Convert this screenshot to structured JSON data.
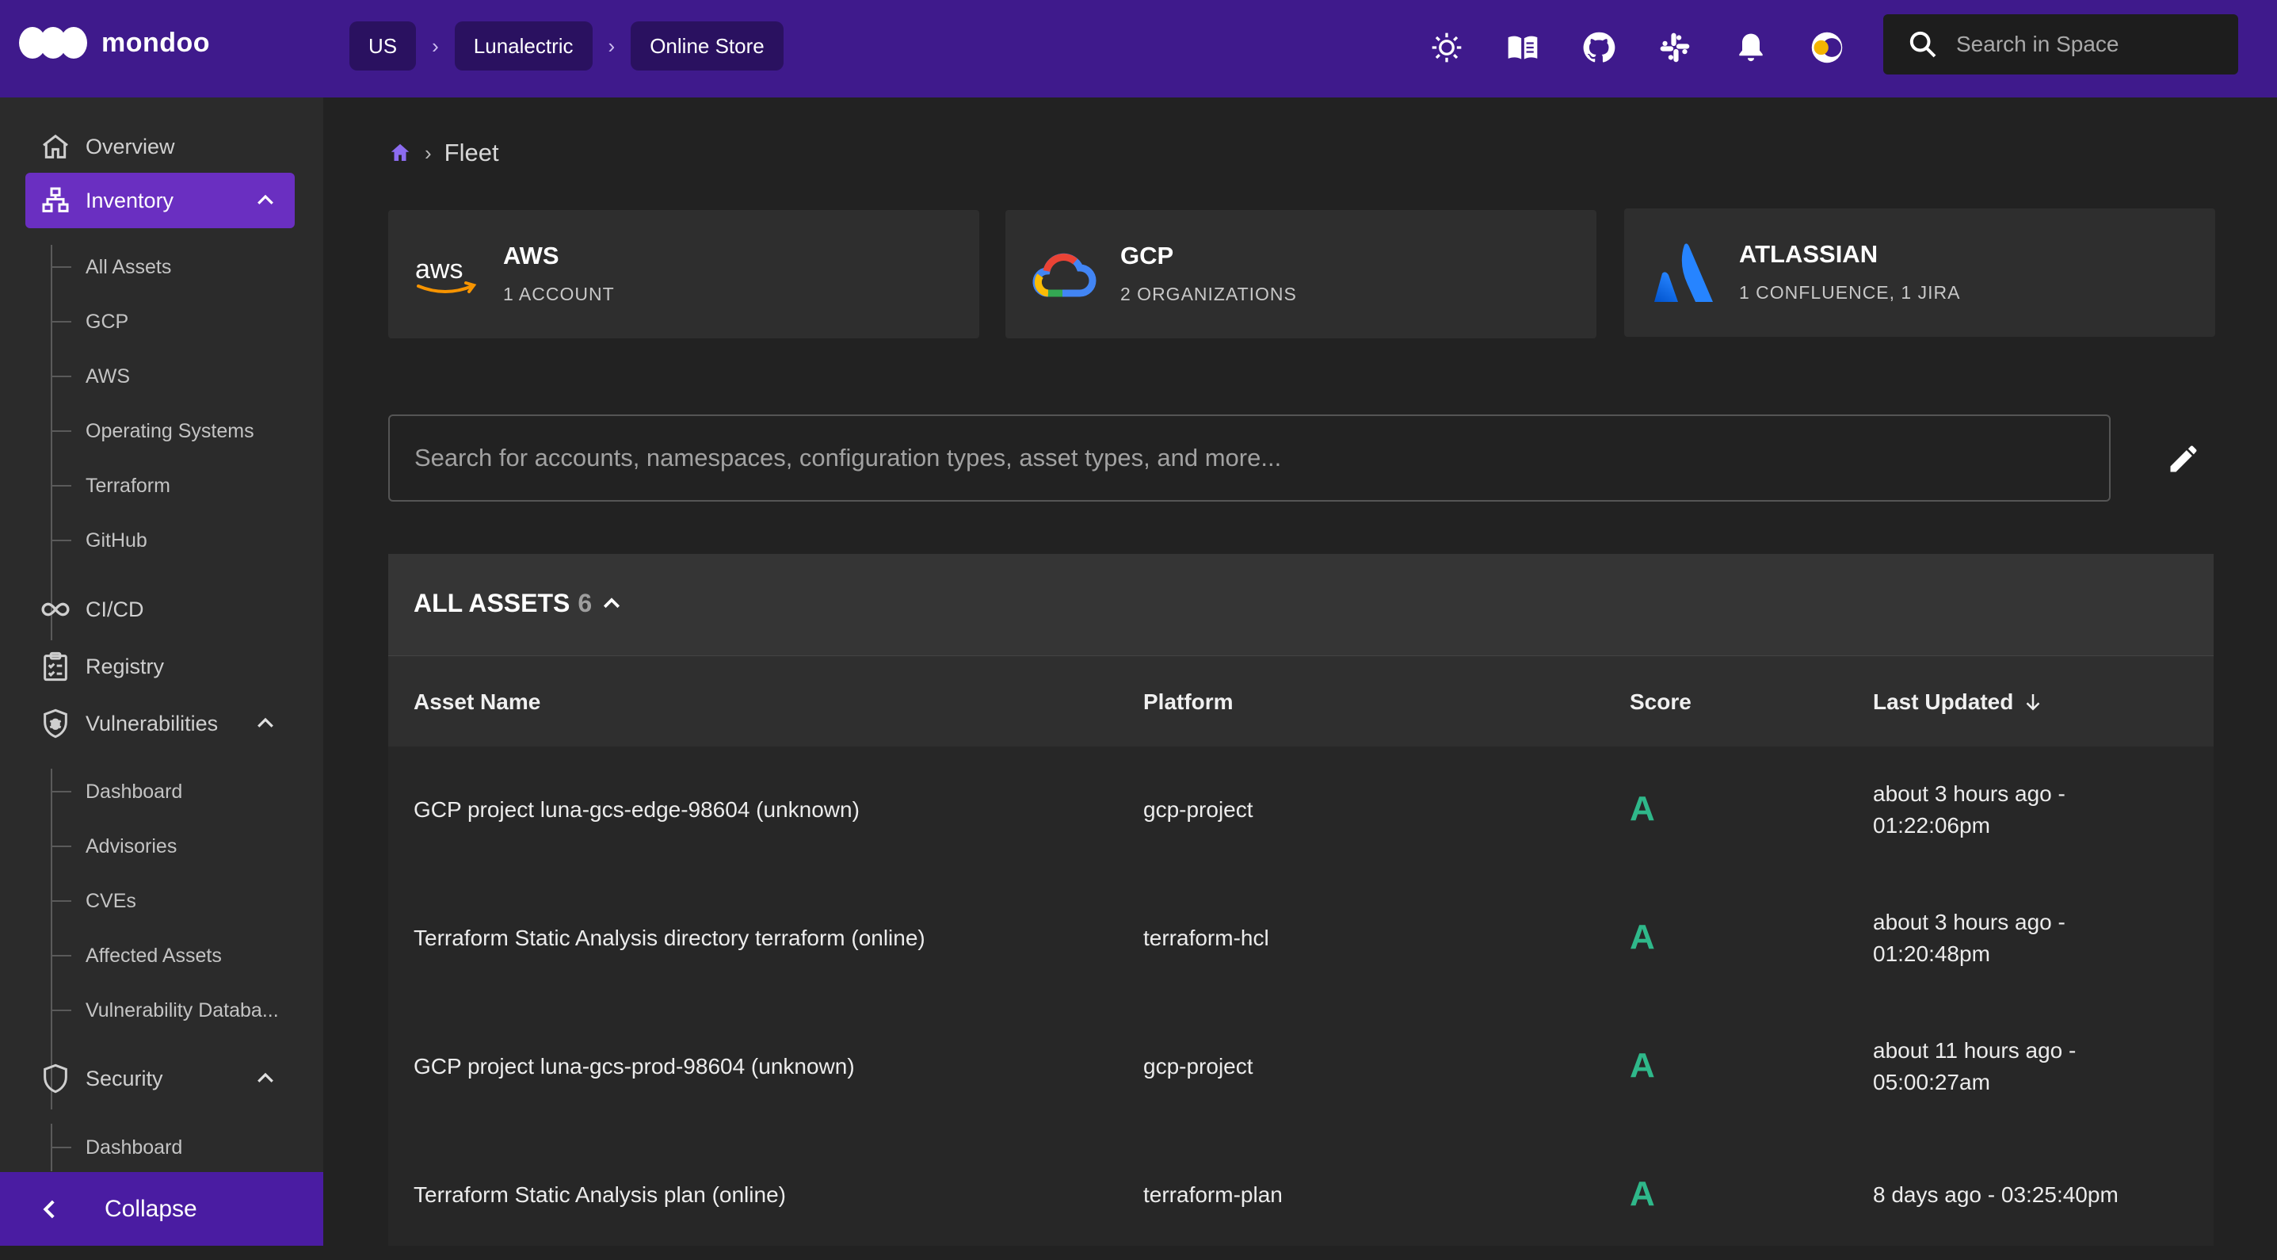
{
  "brand": {
    "name": "mondoo"
  },
  "breadcrumbs": {
    "region": "US",
    "org": "Lunalectric",
    "space": "Online Store"
  },
  "top_icons": [
    "sun-icon",
    "book-icon",
    "github-icon",
    "slack-icon",
    "bell-icon",
    "theme-toggle-icon"
  ],
  "search": {
    "placeholder": "Search in Space"
  },
  "sidebar": {
    "overview": "Overview",
    "inventory": "Inventory",
    "inventory_items": [
      "All Assets",
      "GCP",
      "AWS",
      "Operating Systems",
      "Terraform",
      "GitHub"
    ],
    "cicd": "CI/CD",
    "registry": "Registry",
    "vulnerabilities": "Vulnerabilities",
    "vulnerability_items": [
      "Dashboard",
      "Advisories",
      "CVEs",
      "Affected Assets",
      "Vulnerability Databa..."
    ],
    "security": "Security",
    "security_items": [
      "Dashboard"
    ],
    "collapse": "Collapse"
  },
  "page": {
    "crumb": "Fleet"
  },
  "cards": [
    {
      "logo": "aws",
      "title": "AWS",
      "subtitle": "1 ACCOUNT"
    },
    {
      "logo": "gcp",
      "title": "GCP",
      "subtitle": "2 ORGANIZATIONS"
    },
    {
      "logo": "atlassian",
      "title": "ATLASSIAN",
      "subtitle": "1 CONFLUENCE, 1 JIRA"
    }
  ],
  "filter": {
    "placeholder": "Search for accounts, namespaces, configuration types, asset types, and more..."
  },
  "assets": {
    "title": "ALL ASSETS",
    "count": "6",
    "columns": {
      "name": "Asset Name",
      "platform": "Platform",
      "score": "Score",
      "updated": "Last Updated"
    },
    "rows": [
      {
        "name": "GCP project luna-gcs-edge-98604 (unknown)",
        "platform": "gcp-project",
        "score": "A",
        "updated_1": "about 3 hours ago -",
        "updated_2": "01:22:06pm"
      },
      {
        "name": "Terraform Static Analysis directory terraform (online)",
        "platform": "terraform-hcl",
        "score": "A",
        "updated_1": "about 3 hours ago -",
        "updated_2": "01:20:48pm"
      },
      {
        "name": "GCP project luna-gcs-prod-98604 (unknown)",
        "platform": "gcp-project",
        "score": "A",
        "updated_1": "about 11 hours ago -",
        "updated_2": "05:00:27am"
      },
      {
        "name": "Terraform Static Analysis plan (online)",
        "platform": "terraform-plan",
        "score": "A",
        "updated_1": "8 days ago - 03:25:40pm",
        "updated_2": ""
      }
    ]
  },
  "colors": {
    "topbar": "#3f1a8c",
    "accent": "#6a2fc1",
    "score_a": "#2fb88a"
  }
}
